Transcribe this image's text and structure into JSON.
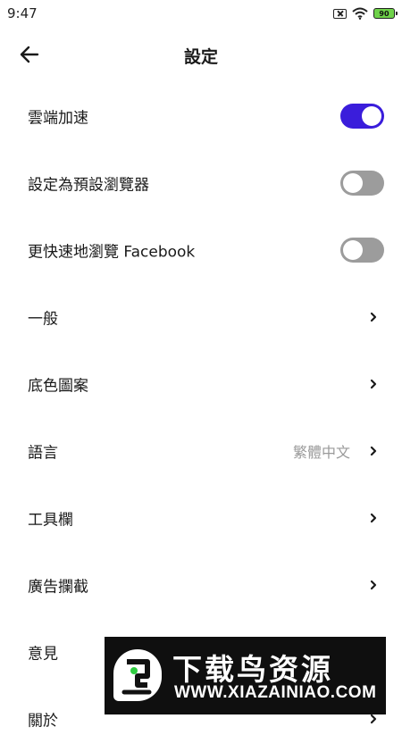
{
  "status_bar": {
    "time": "9:47",
    "battery_level": "90",
    "icons": [
      "sim-off-icon",
      "wifi-icon",
      "battery-icon"
    ]
  },
  "header": {
    "title": "設定",
    "back_icon": "arrow-left-icon"
  },
  "settings": {
    "cloud_acceleration": {
      "label": "雲端加速",
      "enabled": true
    },
    "default_browser": {
      "label": "設定為預設瀏覽器",
      "enabled": false
    },
    "fast_facebook": {
      "label": "更快速地瀏覽 Facebook",
      "enabled": false
    },
    "general": {
      "label": "一般"
    },
    "theme": {
      "label": "底色圖案"
    },
    "language": {
      "label": "語言",
      "value": "繁體中文"
    },
    "toolbar": {
      "label": "工具欄"
    },
    "ad_block": {
      "label": "廣告攔截"
    },
    "feedback": {
      "label": "意見"
    },
    "about": {
      "label": "關於"
    }
  },
  "colors": {
    "accent": "#3a1ddb",
    "toggle_off": "#9c9c9c",
    "value_text": "#9a9a9a"
  },
  "watermark": {
    "title": "下载鸟资源",
    "url": "WWW.XIAZAINIAO.COM"
  }
}
